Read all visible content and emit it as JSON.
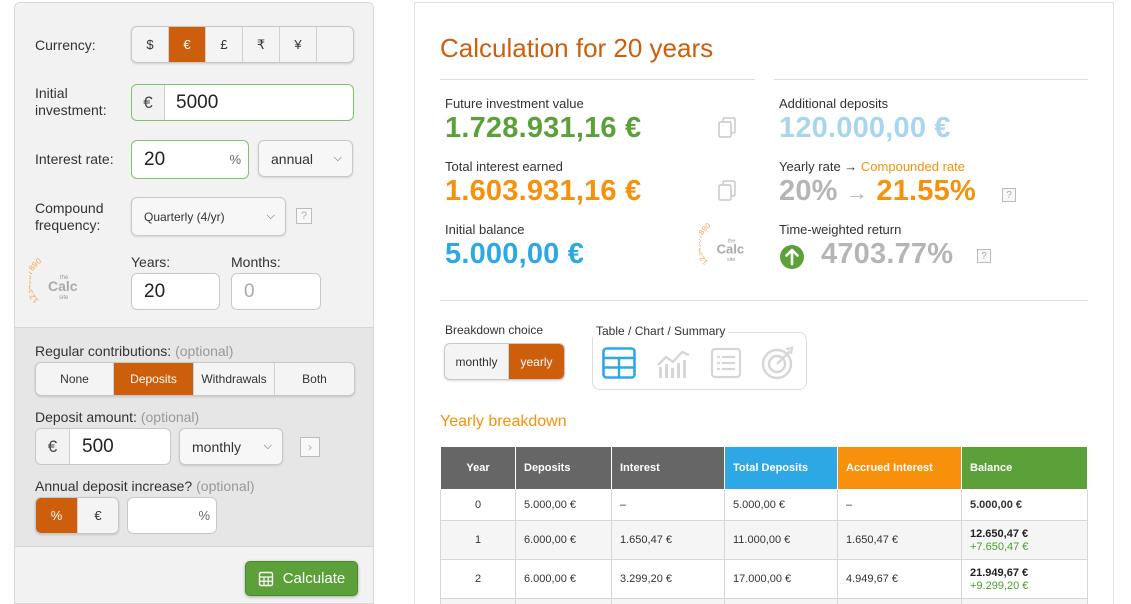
{
  "left": {
    "currency": {
      "label": "Currency:",
      "options": [
        "$",
        "€",
        "£",
        "₹",
        "¥",
        ""
      ],
      "selected": "€"
    },
    "initial": {
      "label_line1": "Initial",
      "label_line2": "investment:",
      "prefix": "€",
      "value": "5000"
    },
    "rate": {
      "label": "Interest rate:",
      "value": "20",
      "suffix": "%",
      "period": "annual"
    },
    "compound": {
      "label_line1": "Compound",
      "label_line2": "frequency:",
      "value": "Quarterly (4/yr)",
      "help": "?"
    },
    "years": {
      "label": "Years:",
      "value": "20"
    },
    "months": {
      "label": "Months:",
      "placeholder": "0"
    },
    "contrib": {
      "label": "Regular contributions:",
      "optional": "(optional)",
      "options": [
        "None",
        "Deposits",
        "Withdrawals",
        "Both"
      ],
      "selected": "Deposits"
    },
    "deposit": {
      "label": "Deposit amount:",
      "optional": "(optional)",
      "prefix": "€",
      "value": "500",
      "period": "monthly"
    },
    "increase": {
      "label": "Annual deposit increase?",
      "optional": "(optional)",
      "options": [
        "%",
        "€"
      ],
      "selected": "%",
      "suffix": "%"
    },
    "calculate": "Calculate"
  },
  "logo": {
    "digits": "1234567890",
    "the": "the",
    "calc": "Calc",
    "site": "site"
  },
  "right": {
    "title": "Calculation for 20 years",
    "future_label": "Future investment value",
    "future_value": "1.728.931,16 €",
    "interest_label": "Total interest earned",
    "interest_value": "1.603.931,16 €",
    "initial_label": "Initial balance",
    "initial_value": "5.000,00 €",
    "additional_label": "Additional deposits",
    "additional_value": "120.000,00 €",
    "yearly_label": "Yearly rate →",
    "compounded_label": "Compounded rate",
    "yearly_value": "20%",
    "arrow": "→",
    "compounded_value": "21.55%",
    "twr_label": "Time-weighted return",
    "twr_value": "4703.77%",
    "breakdown_label": "Breakdown choice",
    "breakdown_options": [
      "monthly",
      "yearly"
    ],
    "breakdown_selected": "yearly",
    "view_label": "Table / Chart / Summary",
    "section_title": "Yearly breakdown",
    "help": "?"
  },
  "colors": {
    "orange": "#f7900a",
    "green": "#5ca03a",
    "blue": "#2ea8e4",
    "lightblue": "#a8d6ee",
    "gray": "#b5b5b5",
    "title": "#cc5e0c"
  },
  "table": {
    "headers": [
      "Year",
      "Deposits",
      "Interest",
      "Total Deposits",
      "Accrued Interest",
      "Balance"
    ],
    "rows": [
      {
        "year": "0",
        "deposits": "5.000,00 €",
        "interest": "–",
        "total": "5.000,00 €",
        "accrued": "–",
        "balance": "5.000,00 €",
        "increase": ""
      },
      {
        "year": "1",
        "deposits": "6.000,00 €",
        "interest": "1.650,47 €",
        "total": "11.000,00 €",
        "accrued": "1.650,47 €",
        "balance": "12.650,47 €",
        "increase": "+7.650,47 €"
      },
      {
        "year": "2",
        "deposits": "6.000,00 €",
        "interest": "3.299,20 €",
        "total": "17.000,00 €",
        "accrued": "4.949,67 €",
        "balance": "21.949,67 €",
        "increase": "+9.299,20 €"
      }
    ]
  }
}
